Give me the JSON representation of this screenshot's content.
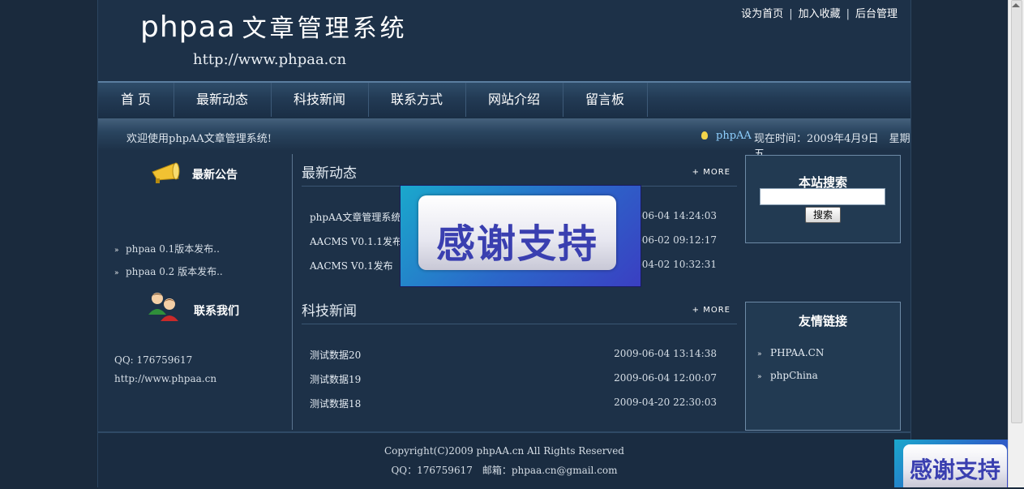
{
  "header": {
    "logo_en": "phpaa",
    "logo_cn": "文章管理系统",
    "logo_url": "http://www.phpaa.cn",
    "toplinks": [
      "设为首页",
      "加入收藏",
      "后台管理"
    ],
    "toplink_separator": "|"
  },
  "nav": {
    "items": [
      "首 页",
      "最新动态",
      "科技新闻",
      "联系方式",
      "网站介绍",
      "留言板"
    ]
  },
  "welcome": {
    "text": "欢迎使用phpAA文章管理系统!",
    "user": "phpAA",
    "time": "现在时间：2009年4月9日　星期五"
  },
  "left": {
    "notice_title": "最新公告",
    "notices": [
      "phpaa 0.1版本发布..",
      "phpaa 0.2 版本发布.."
    ],
    "contact_title": "联系我们",
    "qq": "QQ: 176759617",
    "url": "http://www.phpaa.cn"
  },
  "news": {
    "title": "最新动态",
    "more": "+ MORE",
    "rows": [
      {
        "title": "phpAA文章管理系统",
        "date": "2009-06-04 14:24:03"
      },
      {
        "title": "AACMS V0.1.1发布",
        "date": "2009-06-02 09:12:17"
      },
      {
        "title": "AACMS V0.1发布",
        "date": "2009-04-02 10:32:31"
      }
    ]
  },
  "tech": {
    "title": "科技新闻",
    "more": "+ MORE",
    "rows": [
      {
        "title": "测试数据20",
        "date": "2009-06-04 13:14:38"
      },
      {
        "title": "测试数据19",
        "date": "2009-06-04 12:00:07"
      },
      {
        "title": "测试数据18",
        "date": "2009-04-20 22:30:03"
      }
    ]
  },
  "search": {
    "title": "本站搜索",
    "button": "搜索",
    "value": ""
  },
  "friend_links": {
    "title": "友情链接",
    "items": [
      "PHPAA.CN",
      "phpChina"
    ]
  },
  "footer": {
    "copyright": "Copyright(C)2009 phpAA.cn All Rights Reserved",
    "contact": "QQ：176759617　邮箱：phpaa.cn@gmail.com"
  },
  "overlay": {
    "banner_text": "感谢支持",
    "banner_small_text": "感谢支持"
  }
}
